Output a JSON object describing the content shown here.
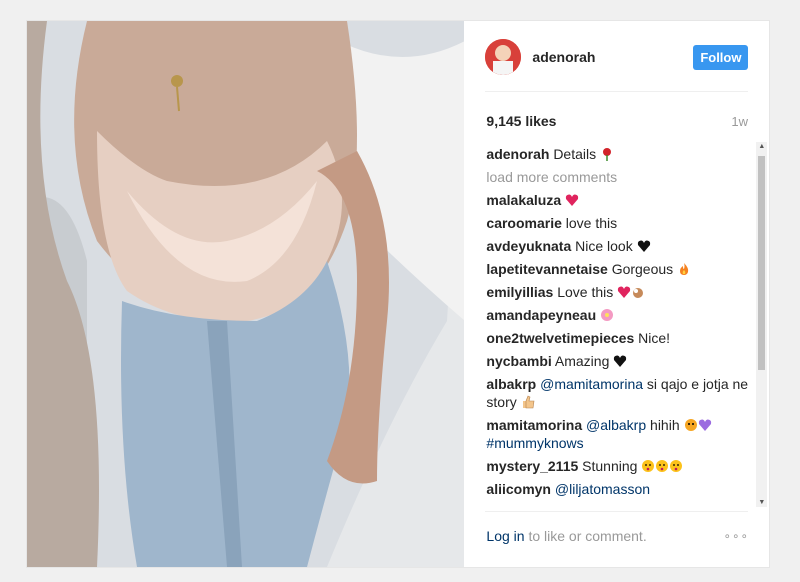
{
  "post": {
    "username": "adenorah",
    "follow_label": "Follow",
    "likes": "9,145 likes",
    "age": "1w",
    "caption_user": "adenorah",
    "caption_text": "Details",
    "load_more": "load more comments",
    "comments": [
      {
        "user": "malakaluza",
        "text": "",
        "emoji": [
          "heart-red"
        ]
      },
      {
        "user": "caroomarie",
        "text": "love this",
        "emoji": []
      },
      {
        "user": "avdeyuknata",
        "text": "Nice look",
        "emoji": [
          "heart-black"
        ]
      },
      {
        "user": "lapetitevannetaise",
        "text": "Gorgeous",
        "emoji": [
          "fire"
        ]
      },
      {
        "user": "emilyillias",
        "text": "Love this",
        "emoji": [
          "heart-red",
          "ok-hand"
        ]
      },
      {
        "user": "amandapeyneau",
        "text": "",
        "emoji": [
          "flower"
        ]
      },
      {
        "user": "one2twelvetimepieces",
        "text": "Nice!",
        "emoji": []
      },
      {
        "user": "nycbambi",
        "text": "Amazing",
        "emoji": [
          "heart-black"
        ]
      },
      {
        "user": "albakrp",
        "mention": "@mamitamorina",
        "text": "si qajo e jotja ne story",
        "emoji": [
          "thumbs-up"
        ]
      },
      {
        "user": "mamitamorina",
        "mention": "@albakrp",
        "text": "hihih",
        "emoji": [
          "tiger",
          "heart-purple"
        ],
        "tag": "#mummyknows"
      },
      {
        "user": "mystery_2115",
        "text": "Stunning",
        "emoji": [
          "kiss-face",
          "kiss-face",
          "kiss-face"
        ]
      },
      {
        "user": "aliicomyn",
        "mention": "@liljatomasson",
        "text": "",
        "emoji": []
      }
    ],
    "login_link": "Log in",
    "login_text": " to like or comment.",
    "more_icon": "ellipsis-icon"
  },
  "colors": {
    "accent": "#3897f0",
    "link": "#003569"
  }
}
